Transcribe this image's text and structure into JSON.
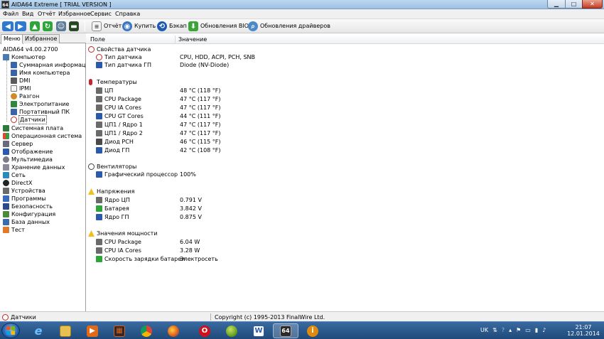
{
  "window": {
    "title": "AIDA64 Extreme  [ TRIAL VERSION ]",
    "app_icon_text": "64",
    "min_glyph": "▁",
    "max_glyph": "□",
    "close_glyph": "✕"
  },
  "menu": [
    "Файл",
    "Вид",
    "Отчёт",
    "Избранное",
    "Сервис",
    "Справка"
  ],
  "toolbar": {
    "report": "Отчёт",
    "buy": "Купить",
    "backup": "Бэкап",
    "bios_update": "Обновления BIOS",
    "driver_update": "Обновления драйверов"
  },
  "left_panel": {
    "tabs": [
      "Меню",
      "Избранное"
    ],
    "version": "AIDA64 v4.00.2700",
    "tree": {
      "computer": "Компьютер",
      "computer_children": [
        "Суммарная информация",
        "Имя компьютера",
        "DMI",
        "IPMI",
        "Разгон",
        "Электропитание",
        "Портативный ПК",
        "Датчики"
      ],
      "top_level": [
        "Системная плата",
        "Операционная система",
        "Сервер",
        "Отображение",
        "Мультимедиа",
        "Хранение данных",
        "Сеть",
        "DirectX",
        "Устройства",
        "Программы",
        "Безопасность",
        "Конфигурация",
        "База данных",
        "Тест"
      ]
    }
  },
  "columns": {
    "field": "Поле",
    "value": "Значение"
  },
  "sections": {
    "sensor_props": {
      "title": "Свойства датчика",
      "rows": [
        {
          "label": "Тип датчика",
          "value": "CPU, HDD, ACPI, PCH, SNB"
        },
        {
          "label": "Тип датчика ГП",
          "value": "Diode  (NV-Diode)"
        }
      ]
    },
    "temperatures": {
      "title": "Температуры",
      "rows": [
        {
          "label": "ЦП",
          "value": "48 °C  (118 °F)"
        },
        {
          "label": "CPU Package",
          "value": "47 °C  (117 °F)"
        },
        {
          "label": "CPU IA Cores",
          "value": "47 °C  (117 °F)"
        },
        {
          "label": "CPU GT Cores",
          "value": "44 °C  (111 °F)"
        },
        {
          "label": "ЦП1 / Ядро 1",
          "value": "47 °C  (117 °F)"
        },
        {
          "label": "ЦП1 / Ядро 2",
          "value": "47 °C  (117 °F)"
        },
        {
          "label": "Диод PCH",
          "value": "46 °C  (115 °F)"
        },
        {
          "label": "Диод ГП",
          "value": "42 °C  (108 °F)"
        }
      ]
    },
    "fans": {
      "title": "Вентиляторы",
      "rows": [
        {
          "label": "Графический процессор",
          "value": "100%"
        }
      ]
    },
    "voltages": {
      "title": "Напряжения",
      "rows": [
        {
          "label": "Ядро ЦП",
          "value": "0.791 V"
        },
        {
          "label": "Батарея",
          "value": "3.842 V"
        },
        {
          "label": "Ядро ГП",
          "value": "0.875 V"
        }
      ]
    },
    "power": {
      "title": "Значения мощности",
      "rows": [
        {
          "label": "CPU Package",
          "value": "6.04 W"
        },
        {
          "label": "CPU IA Cores",
          "value": "3.28 W"
        },
        {
          "label": "Скорость зарядки батареи",
          "value": "Электросеть"
        }
      ]
    }
  },
  "statusbar": {
    "current": "Датчики",
    "copyright": "Copyright (c) 1995-2013 FinalWire Ltd."
  },
  "taskbar": {
    "lang": "UK",
    "time": "21:07",
    "date": "12.01.2014",
    "apps": {
      "ie": "e",
      "aida": "64",
      "info": "i",
      "word": "W"
    }
  },
  "colors": {
    "title_gradient_top": "#bcd8f0",
    "close_red": "#c43c24",
    "taskbar_blue": "#1f4a7a",
    "temp_red": "#c0282c",
    "warn_yellow": "#f0c020"
  }
}
